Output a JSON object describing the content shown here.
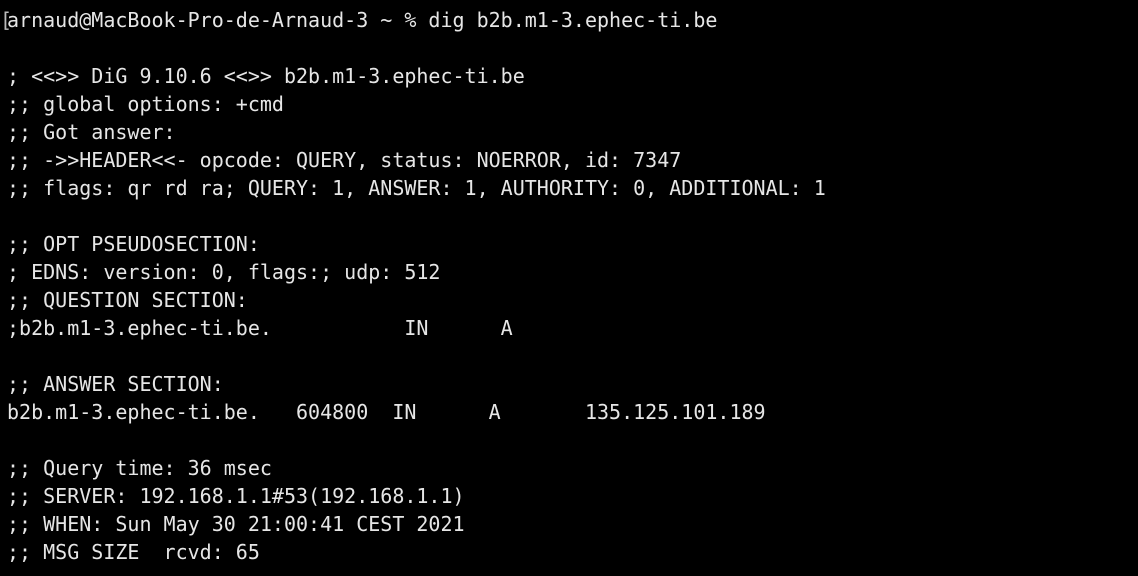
{
  "terminal": {
    "background": "#000000",
    "foreground": "#e6e6e6",
    "prompt_marker": "[",
    "prompt": "arnaud@MacBook-Pro-de-Arnaud-3 ~ % dig b2b.m1-3.ephec-ti.be",
    "lines": [
      "",
      "; <<>> DiG 9.10.6 <<>> b2b.m1-3.ephec-ti.be",
      ";; global options: +cmd",
      ";; Got answer:",
      ";; ->>HEADER<<- opcode: QUERY, status: NOERROR, id: 7347",
      ";; flags: qr rd ra; QUERY: 1, ANSWER: 1, AUTHORITY: 0, ADDITIONAL: 1",
      "",
      ";; OPT PSEUDOSECTION:",
      "; EDNS: version: 0, flags:; udp: 512",
      ";; QUESTION SECTION:",
      ";b2b.m1-3.ephec-ti.be.           IN      A",
      "",
      ";; ANSWER SECTION:",
      "b2b.m1-3.ephec-ti.be.   604800  IN      A       135.125.101.189",
      "",
      ";; Query time: 36 msec",
      ";; SERVER: 192.168.1.1#53(192.168.1.1)",
      ";; WHEN: Sun May 30 21:00:41 CEST 2021",
      ";; MSG SIZE  rcvd: 65"
    ]
  }
}
